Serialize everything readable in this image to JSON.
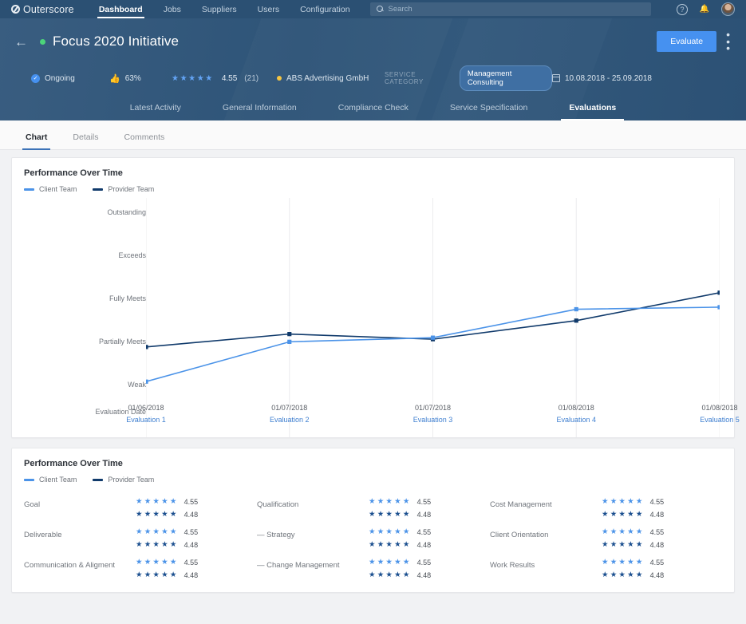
{
  "topnav": {
    "brand": "Outerscore",
    "brand_icon": "outerscore-logo-icon",
    "items": [
      {
        "label": "Dashboard",
        "active": true
      },
      {
        "label": "Jobs",
        "active": false
      },
      {
        "label": "Suppliers",
        "active": false
      },
      {
        "label": "Users",
        "active": false
      },
      {
        "label": "Configuration",
        "active": false
      }
    ],
    "search": {
      "placeholder": "Search",
      "value": "",
      "icon": "search-icon"
    },
    "help_icon": "help-circle-icon",
    "notifications_icon": "bell-icon",
    "avatar": "user-avatar"
  },
  "pagehead": {
    "back_icon": "back-arrow-icon",
    "status_dot_color": "#4cd47a",
    "title": "Focus 2020 Initiative",
    "evaluate_label": "Evaluate",
    "more_icon": "kebab-menu-icon",
    "meta": {
      "status": "Ongoing",
      "status_icon": "check-circle-icon",
      "thumbs_icon": "thumbs-up-icon",
      "thumbs_percent": "63%",
      "stars": "★★★★★",
      "rating": "4.55",
      "rating_count": "(21)",
      "supplier_dot_color": "#f5c542",
      "supplier": "ABS Advertising GmbH",
      "service_category_label": "SERVICE CATEGORY",
      "service_category": "Management Consulting",
      "calendar_icon": "calendar-icon",
      "date_range": "10.08.2018 - 25.09.2018"
    },
    "tabs": [
      {
        "label": "Latest Activity",
        "active": false
      },
      {
        "label": "General Information",
        "active": false
      },
      {
        "label": "Compliance Check",
        "active": false
      },
      {
        "label": "Service Specification",
        "active": false
      },
      {
        "label": "Evaluations",
        "active": true
      }
    ]
  },
  "subtabs": [
    {
      "label": "Chart",
      "active": true
    },
    {
      "label": "Details",
      "active": false
    },
    {
      "label": "Comments",
      "active": false
    }
  ],
  "chart_card": {
    "title": "Performance Over Time",
    "legend": [
      {
        "label": "Client Team",
        "color": "#4b93e8"
      },
      {
        "label": "Provider Team",
        "color": "#103a6b"
      }
    ]
  },
  "ratings_card": {
    "title": "Performance Over Time",
    "legend": [
      {
        "label": "Client Team",
        "color": "#4b93e8"
      },
      {
        "label": "Provider Team",
        "color": "#103a6b"
      }
    ],
    "rows": [
      {
        "label": "Goal",
        "client": "4.55",
        "provider": "4.48"
      },
      {
        "label": "Qualification",
        "client": "4.55",
        "provider": "4.48"
      },
      {
        "label": "Cost Management",
        "client": "4.55",
        "provider": "4.48"
      },
      {
        "label": "Deliverable",
        "client": "4.55",
        "provider": "4.48"
      },
      {
        "label": "—  Strategy",
        "client": "4.55",
        "provider": "4.48"
      },
      {
        "label": "Client Orientation",
        "client": "4.55",
        "provider": "4.48"
      },
      {
        "label": "Communication & Aligment",
        "client": "4.55",
        "provider": "4.48"
      },
      {
        "label": "—  Change Management",
        "client": "4.55",
        "provider": "4.48"
      },
      {
        "label": "Work Results",
        "client": "4.55",
        "provider": "4.48"
      }
    ],
    "stars_full": "★★★★",
    "stars_half": "★"
  },
  "chart_data": {
    "type": "line",
    "title": "Performance Over Time",
    "xlabel": "Evaluation Date",
    "ylabel": "",
    "y_categories": [
      "Weak",
      "Partially Meets",
      "Fully Meets",
      "Exceeds",
      "Outstanding"
    ],
    "ylim": [
      0,
      5
    ],
    "grid": true,
    "legend_position": "top-left",
    "x_axis_title": "Evaluation Date",
    "x": [
      "Evaluation 1",
      "Evaluation 2",
      "Evaluation 3",
      "Evaluation 4",
      "Evaluation 5"
    ],
    "x_dates": [
      "01/06/2018",
      "01/07/2018",
      "01/07/2018",
      "01/08/2018",
      "01/08/2018"
    ],
    "series": [
      {
        "name": "Client Team",
        "color": "#4b93e8",
        "values": [
          1.78,
          2.55,
          2.63,
          3.18,
          3.22
        ]
      },
      {
        "name": "Provider Team",
        "color": "#103a6b",
        "values": [
          2.45,
          2.7,
          2.6,
          2.96,
          3.5
        ]
      }
    ]
  }
}
